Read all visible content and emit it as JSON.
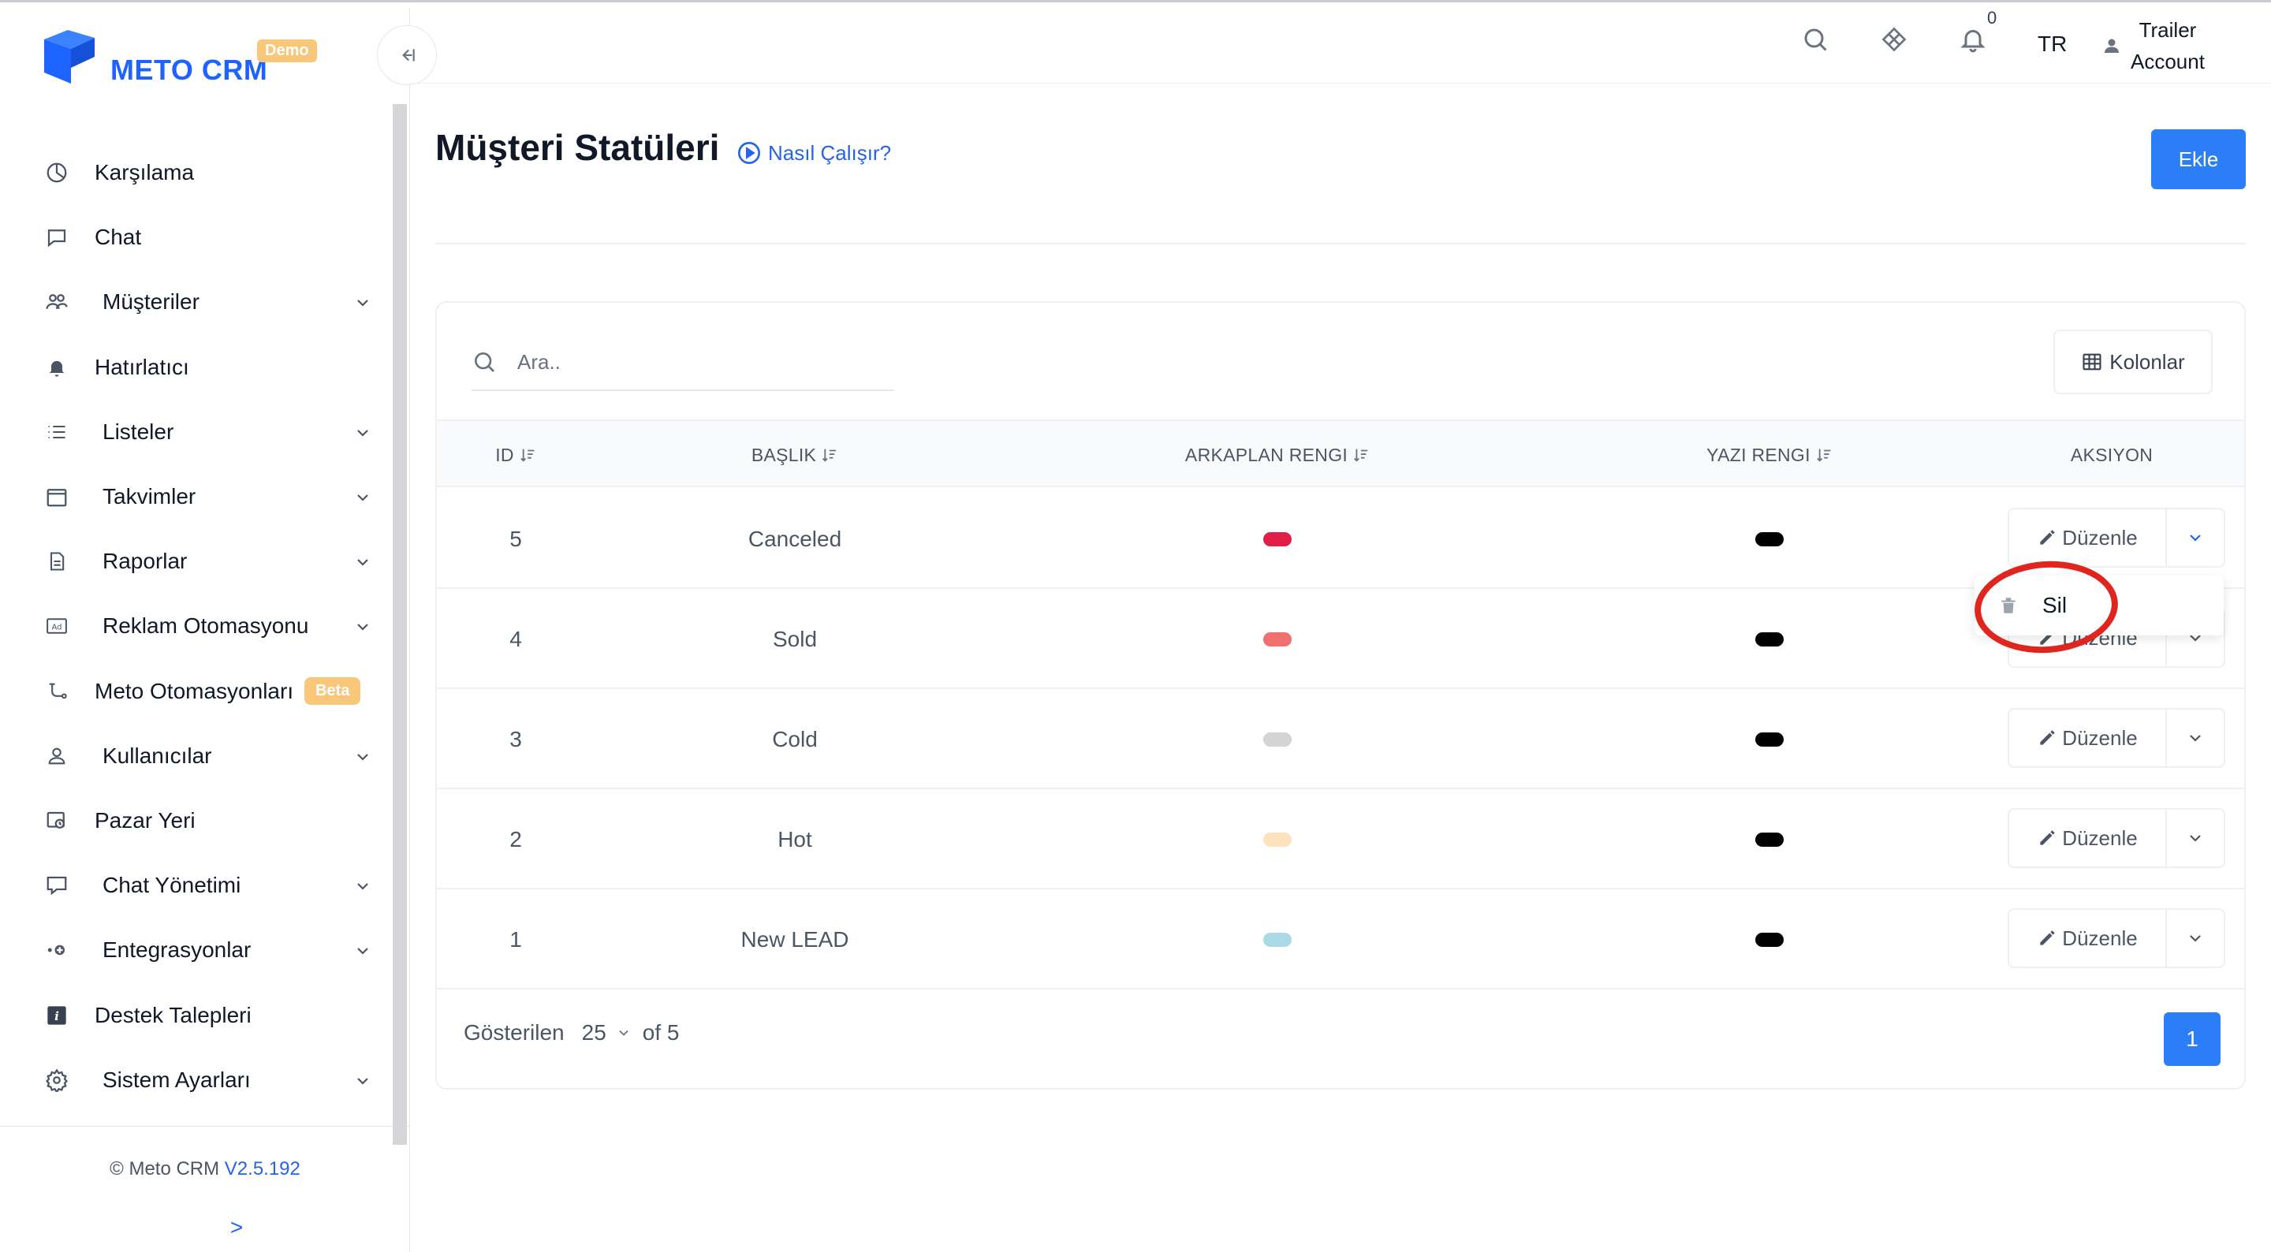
{
  "app": {
    "logo_text": "METO CRM",
    "logo_badge": "Demo",
    "brand_color": "#1d63ff",
    "accent_color": "#2b7ef5"
  },
  "sidebar": {
    "items": [
      {
        "label": "Karşılama",
        "icon": "pie-chart-icon",
        "has_chevron": false
      },
      {
        "label": "Chat",
        "icon": "chat-bubble-icon",
        "has_chevron": false
      },
      {
        "label": "Müşteriler",
        "icon": "users-icon",
        "has_chevron": true
      },
      {
        "label": "Hatırlatıcı",
        "icon": "bell-icon",
        "has_chevron": false
      },
      {
        "label": "Listeler",
        "icon": "list-icon",
        "has_chevron": true
      },
      {
        "label": "Takvimler",
        "icon": "calendar-icon",
        "has_chevron": true
      },
      {
        "label": "Raporlar",
        "icon": "document-icon",
        "has_chevron": true
      },
      {
        "label": "Reklam Otomasyonu",
        "icon": "ad-icon",
        "has_chevron": true
      },
      {
        "label": "Meto Otomasyonları",
        "icon": "automation-icon",
        "has_chevron": false,
        "badge": "Beta"
      },
      {
        "label": "Kullanıcılar",
        "icon": "user-icon",
        "has_chevron": true
      },
      {
        "label": "Pazar Yeri",
        "icon": "marketplace-icon",
        "has_chevron": false
      },
      {
        "label": "Chat Yönetimi",
        "icon": "chat-settings-icon",
        "has_chevron": true
      },
      {
        "label": "Entegrasyonlar",
        "icon": "plug-icon",
        "has_chevron": true
      },
      {
        "label": "Destek Talepleri",
        "icon": "info-icon",
        "has_chevron": false
      },
      {
        "label": "Sistem Ayarları",
        "icon": "gear-icon",
        "has_chevron": true
      }
    ],
    "footer": {
      "copyright": "© Meto CRM",
      "version": "V2.5.192",
      "expand": ">"
    }
  },
  "header": {
    "notification_count": "0",
    "language": "TR",
    "account_line1": "Trailer",
    "account_line2": "Account"
  },
  "page": {
    "title": "Müşteri Statüleri",
    "how_it_works": "Nasıl Çalışır?",
    "add_button": "Ekle"
  },
  "table": {
    "search_placeholder": "Ara..",
    "columns_button": "Kolonlar",
    "headers": {
      "id": "ID",
      "title": "BAŞLIK",
      "bg_color": "ARKAPLAN RENGI",
      "text_color": "YAZI RENGI",
      "action": "AKSIYON"
    },
    "rows": [
      {
        "id": "5",
        "title": "Canceled",
        "bg_color": "#e11d48",
        "text_color": "#000000",
        "edit": "Düzenle"
      },
      {
        "id": "4",
        "title": "Sold",
        "bg_color": "#f07070",
        "text_color": "#000000",
        "edit": "Düzenle"
      },
      {
        "id": "3",
        "title": "Cold",
        "bg_color": "#d4d4d4",
        "text_color": "#000000",
        "edit": "Düzenle"
      },
      {
        "id": "2",
        "title": "Hot",
        "bg_color": "#fde2c0",
        "text_color": "#000000",
        "edit": "Düzenle"
      },
      {
        "id": "1",
        "title": "New LEAD",
        "bg_color": "#a9d8e6",
        "text_color": "#000000",
        "edit": "Düzenle"
      }
    ],
    "dropdown": {
      "delete_label": "Sil"
    },
    "footer": {
      "shown_label": "Gösterilen",
      "per_page": "25",
      "of_total": "of 5",
      "current_page": "1"
    }
  }
}
